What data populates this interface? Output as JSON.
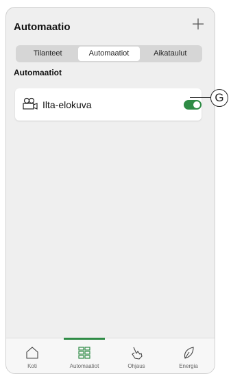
{
  "header": {
    "title": "Automaatio",
    "add_icon": "plus-icon"
  },
  "tabs": [
    {
      "label": "Tilanteet",
      "active": false
    },
    {
      "label": "Automaatiot",
      "active": true
    },
    {
      "label": "Aikataulut",
      "active": false
    }
  ],
  "section": {
    "title": "Automaatiot"
  },
  "automations": [
    {
      "name": "Ilta-elokuva",
      "icon": "movie-camera-icon",
      "enabled": true
    }
  ],
  "callout": {
    "label": "G"
  },
  "bottom_nav": [
    {
      "label": "Koti",
      "icon": "home-icon",
      "active": false
    },
    {
      "label": "Automaatiot",
      "icon": "grid-icon",
      "active": true
    },
    {
      "label": "Ohjaus",
      "icon": "hand-icon",
      "active": false
    },
    {
      "label": "Energia",
      "icon": "leaf-icon",
      "active": false
    }
  ],
  "colors": {
    "accent": "#2e8b45",
    "background": "#efefef"
  }
}
